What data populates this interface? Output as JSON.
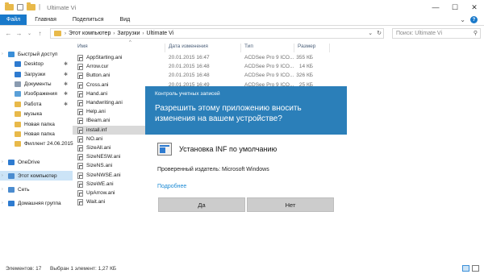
{
  "window": {
    "title": "Ultimate Vi",
    "title_sep": "|",
    "minimize_glyph": "—",
    "maximize_glyph": "☐",
    "close_glyph": "✕"
  },
  "ribbon": {
    "tabs": [
      "Файл",
      "Главная",
      "Поделиться",
      "Вид"
    ],
    "expand_glyph": "⌄",
    "help_glyph": "?"
  },
  "address": {
    "back_glyph": "←",
    "forward_glyph": "→",
    "recent_glyph": "⌄",
    "up_glyph": "↑",
    "crumb_sep": "›",
    "crumbs": [
      "Этот компьютер",
      "Загрузки",
      "Ultimate Vi"
    ],
    "dropdown_glyph": "⌄",
    "refresh_glyph": "↻",
    "search_placeholder": "Поиск: Ultimate Vi",
    "search_glyph": "⚲"
  },
  "nav": {
    "items": [
      {
        "label": "Быстрый доступ",
        "icon": "star-icon",
        "color": "#3b8fd8",
        "pinned": false
      },
      {
        "label": "Desktop",
        "icon": "desktop-icon",
        "color": "#2e7bd0",
        "pinned": true
      },
      {
        "label": "Загрузки",
        "icon": "download-icon",
        "color": "#2e7bd0",
        "pinned": true
      },
      {
        "label": "Документы",
        "icon": "documents-icon",
        "color": "#8a9bb0",
        "pinned": true
      },
      {
        "label": "Изображения",
        "icon": "pictures-icon",
        "color": "#5aa0d8",
        "pinned": true
      },
      {
        "label": "Работа",
        "icon": "folder-icon",
        "color": "#e8b94a",
        "pinned": true
      },
      {
        "label": "музыка",
        "icon": "folder-icon",
        "color": "#e8b94a",
        "pinned": false
      },
      {
        "label": "Новая папка",
        "icon": "folder-icon",
        "color": "#e8b94a",
        "pinned": false
      },
      {
        "label": "Новая папка",
        "icon": "folder-icon",
        "color": "#e8b94a",
        "pinned": false
      },
      {
        "label": "Филлент 24.06.2015",
        "icon": "folder-icon",
        "color": "#e8b94a",
        "pinned": false
      },
      {
        "label": "OneDrive",
        "icon": "cloud-icon",
        "color": "#2e7bd0",
        "pinned": false
      },
      {
        "label": "Этот компьютер",
        "icon": "computer-icon",
        "color": "#4b8ccf",
        "pinned": false
      },
      {
        "label": "Сеть",
        "icon": "network-icon",
        "color": "#4b8ccf",
        "pinned": false
      },
      {
        "label": "Домашняя группа",
        "icon": "homegroup-icon",
        "color": "#2e7bd0",
        "pinned": false
      }
    ],
    "pin_glyph": "✱",
    "caret_glyph": "›"
  },
  "columns": {
    "name": "Имя",
    "date": "Дата изменения",
    "type": "Тип",
    "size": "Размер",
    "sort_glyph": "^"
  },
  "files": [
    {
      "name": "AppStarting.ani",
      "date": "20.01.2015 16:47",
      "type": "ACDSee Pro 9 ICO...",
      "size": "355 КБ"
    },
    {
      "name": "Arrow.cur",
      "date": "20.01.2015 16:48",
      "type": "ACDSee Pro 9 ICO...",
      "size": "14 КБ"
    },
    {
      "name": "Button.ani",
      "date": "20.01.2015 16:48",
      "type": "ACDSee Pro 9 ICO...",
      "size": "326 КБ"
    },
    {
      "name": "Cross.ani",
      "date": "20.01.2015 16:49",
      "type": "ACDSee Pro 9 ICO...",
      "size": "25 КБ"
    },
    {
      "name": "Hand.ani",
      "date": "",
      "type": "",
      "size": ""
    },
    {
      "name": "Handwriting.ani",
      "date": "",
      "type": "",
      "size": ""
    },
    {
      "name": "Help.ani",
      "date": "",
      "type": "",
      "size": ""
    },
    {
      "name": "IBeam.ani",
      "date": "",
      "type": "",
      "size": ""
    },
    {
      "name": "install.inf",
      "date": "",
      "type": "",
      "size": ""
    },
    {
      "name": "NO.ani",
      "date": "",
      "type": "",
      "size": ""
    },
    {
      "name": "SizeAll.ani",
      "date": "",
      "type": "",
      "size": ""
    },
    {
      "name": "SizeNESW.ani",
      "date": "",
      "type": "",
      "size": ""
    },
    {
      "name": "SizeNS.ani",
      "date": "",
      "type": "",
      "size": ""
    },
    {
      "name": "SizeNWSE.ani",
      "date": "",
      "type": "",
      "size": ""
    },
    {
      "name": "SizeWE.ani",
      "date": "",
      "type": "",
      "size": ""
    },
    {
      "name": "UpArrow.ani",
      "date": "",
      "type": "",
      "size": ""
    },
    {
      "name": "Wait.ani",
      "date": "",
      "type": "",
      "size": ""
    }
  ],
  "status": {
    "count": "Элементов: 17",
    "selected": "Выбран 1 элемент: 1,27 КБ"
  },
  "uac": {
    "caption": "Контроль учетных записей",
    "question": "Разрешить этому приложению вносить изменения на вашем устройстве?",
    "app_name": "Установка INF по умолчанию",
    "publisher": "Проверенный издатель: Microsoft Windows",
    "details_link": "Подробнее",
    "yes_label": "Да",
    "no_label": "Нет"
  }
}
